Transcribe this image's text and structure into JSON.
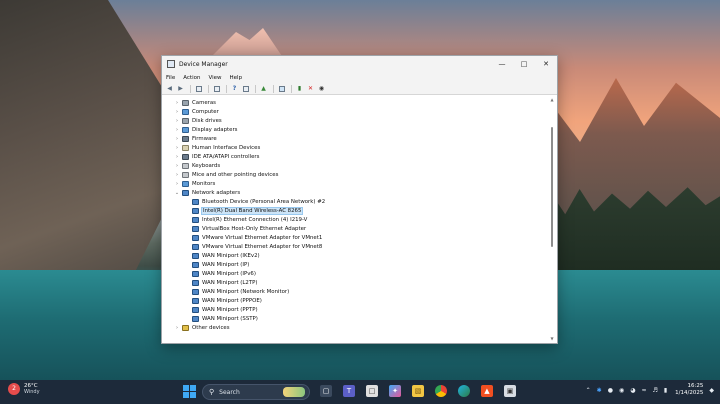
{
  "window": {
    "title": "Device Manager",
    "menu": [
      "File",
      "Action",
      "View",
      "Help"
    ]
  },
  "tree": {
    "items": [
      {
        "label": "Cameras",
        "icon": "camera-icon",
        "expanded": false
      },
      {
        "label": "Computer",
        "icon": "computer-icon",
        "expanded": false
      },
      {
        "label": "Disk drives",
        "icon": "disk-icon",
        "expanded": false
      },
      {
        "label": "Display adapters",
        "icon": "display-icon",
        "expanded": false
      },
      {
        "label": "Firmware",
        "icon": "chip-icon",
        "expanded": false
      },
      {
        "label": "Human Interface Devices",
        "icon": "hid-icon",
        "expanded": false
      },
      {
        "label": "IDE ATA/ATAPI controllers",
        "icon": "controller-icon",
        "expanded": false
      },
      {
        "label": "Keyboards",
        "icon": "keyboard-icon",
        "expanded": false
      },
      {
        "label": "Mice and other pointing devices",
        "icon": "mouse-icon",
        "expanded": false
      },
      {
        "label": "Monitors",
        "icon": "monitor-icon",
        "expanded": false
      },
      {
        "label": "Network adapters",
        "icon": "network-icon",
        "expanded": true
      }
    ],
    "network_children": [
      {
        "label": "Bluetooth Device (Personal Area Network) #2",
        "selected": false
      },
      {
        "label": "Intel(R) Dual Band Wireless-AC 8265",
        "selected": true
      },
      {
        "label": "Intel(R) Ethernet Connection (4) I219-V",
        "selected": false
      },
      {
        "label": "VirtualBox Host-Only Ethernet Adapter",
        "selected": false
      },
      {
        "label": "VMware Virtual Ethernet Adapter for VMnet1",
        "selected": false
      },
      {
        "label": "VMware Virtual Ethernet Adapter for VMnet8",
        "selected": false
      },
      {
        "label": "WAN Miniport (IKEv2)",
        "selected": false
      },
      {
        "label": "WAN Miniport (IP)",
        "selected": false
      },
      {
        "label": "WAN Miniport (IPv6)",
        "selected": false
      },
      {
        "label": "WAN Miniport (L2TP)",
        "selected": false
      },
      {
        "label": "WAN Miniport (Network Monitor)",
        "selected": false
      },
      {
        "label": "WAN Miniport (PPPOE)",
        "selected": false
      },
      {
        "label": "WAN Miniport (PPTP)",
        "selected": false
      },
      {
        "label": "WAN Miniport (SSTP)",
        "selected": false
      }
    ],
    "trailing": {
      "label": "Other devices",
      "icon": "warning-icon"
    }
  },
  "taskbar": {
    "weather_temp": "26°C",
    "weather_cond": "Windy",
    "weather_badge": "2",
    "search_placeholder": "Search",
    "time": "16:25",
    "date": "1/14/2025"
  }
}
